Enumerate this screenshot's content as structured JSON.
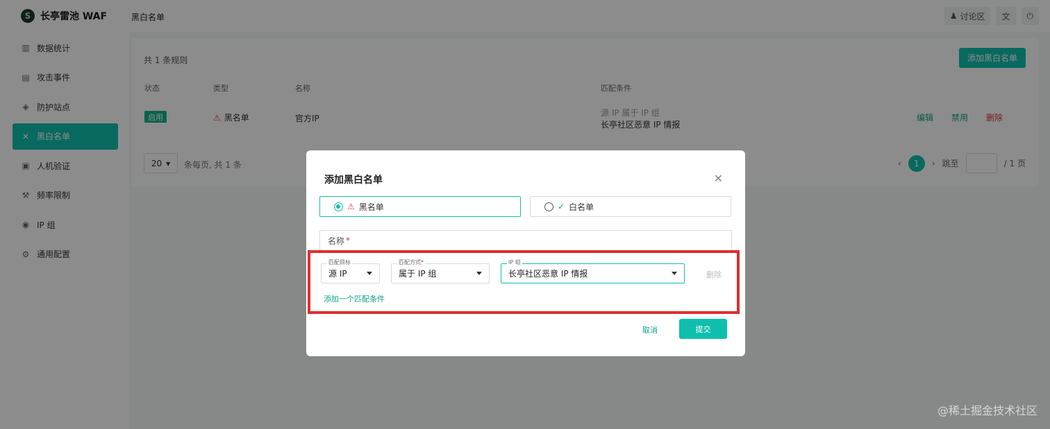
{
  "brand": {
    "name": "长亭雷池 WAF"
  },
  "topbar": {
    "breadcrumb": "黑白名单",
    "forum": "讨论区"
  },
  "sidebar": {
    "items": [
      {
        "label": "数据统计",
        "icon": "bar-chart-icon"
      },
      {
        "label": "攻击事件",
        "icon": "document-icon"
      },
      {
        "label": "防护站点",
        "icon": "shield-icon"
      },
      {
        "label": "黑白名单",
        "icon": "tools-icon",
        "active": true
      },
      {
        "label": "人机验证",
        "icon": "id-card-icon"
      },
      {
        "label": "频率限制",
        "icon": "wrench-icon"
      },
      {
        "label": "IP 组",
        "icon": "location-icon"
      },
      {
        "label": "通用配置",
        "icon": "settings-icon"
      }
    ]
  },
  "rules": {
    "count_text": "共 1 条规则",
    "add_button": "添加黑白名单",
    "columns": [
      "状态",
      "类型",
      "名称",
      "匹配条件"
    ],
    "row": {
      "status": "启用",
      "type": "黑名单",
      "name": "官方IP",
      "cond_key": "源 IP 属于 IP 组",
      "cond_value": "长亭社区恶意 IP 情报",
      "actions": {
        "edit": "编辑",
        "disable": "禁用",
        "delete": "删除"
      }
    },
    "pagination": {
      "page_size": "20",
      "per_page_text": "条每页, 共 1 条",
      "current_page": "1",
      "jump_label": "跳至",
      "total_pages": "/ 1 页"
    }
  },
  "modal": {
    "title": "添加黑白名单",
    "options": {
      "blacklist": "黑名单",
      "whitelist": "白名单"
    },
    "name_placeholder": "名称",
    "condition": {
      "target_label": "匹配目标",
      "target_value": "源 IP",
      "method_label": "匹配方式",
      "method_value": "属于 IP 组",
      "ipgroup_label": "IP 组",
      "ipgroup_value": "长亭社区恶意 IP 情报",
      "delete": "删除"
    },
    "add_condition": "添加一个匹配条件",
    "cancel": "取消",
    "submit": "提交"
  },
  "watermark": "@稀土掘金技术社区",
  "colors": {
    "accent": "#0fbfae",
    "danger": "#d9363e",
    "highlight": "#e02e2e"
  }
}
